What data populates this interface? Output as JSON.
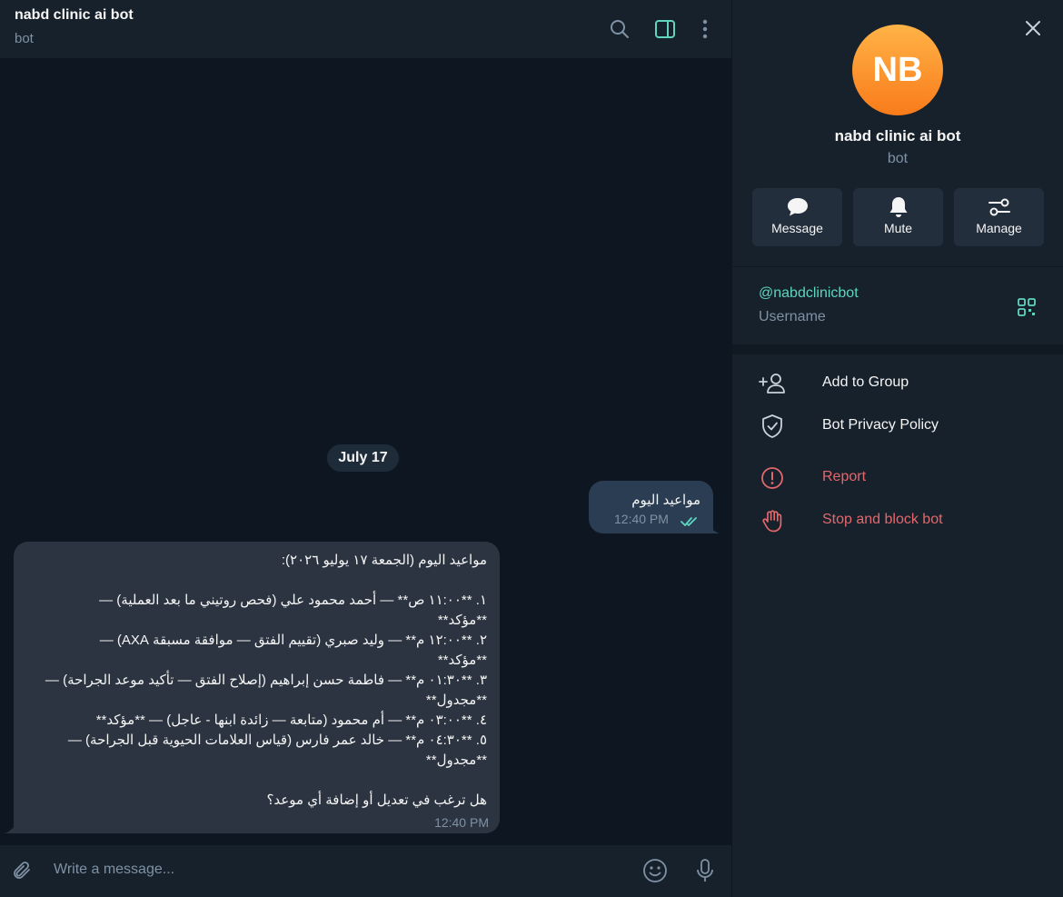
{
  "chat": {
    "title": "nabd clinic ai bot",
    "subtitle": "bot",
    "date_pill": "July 17",
    "outgoing": {
      "text": "مواعيد اليوم",
      "time": "12:40 PM"
    },
    "incoming": {
      "lines": [
        "مواعيد اليوم (الجمعة ١٧ يوليو ٢٠٢٦):",
        "",
        "١. **١١:٠٠ ص** — أحمد محمود علي (فحص روتيني ما بعد العملية) —",
        "**مؤكد**",
        "٢. **١٢:٠٠ م** — وليد صبري (تقييم الفتق — موافقة مسبقة AXA) —",
        "**مؤكد**",
        "٣. **٠١:٣٠ م** — فاطمة حسن إبراهيم (إصلاح الفتق — تأكيد موعد الجراحة) —",
        "**مجدول**",
        "٤. **٠٣:٠٠ م** — أم محمود (متابعة — زائدة ابنها - عاجل) — **مؤكد**",
        "٥. **٠٤:٣٠ م** — خالد عمر فارس (قياس العلامات الحيوية قبل الجراحة) —",
        "**مجدول**",
        "",
        "هل ترغب في تعديل أو إضافة أي موعد؟"
      ],
      "time": "12:40 PM"
    },
    "composer_placeholder": "Write a message..."
  },
  "panel": {
    "avatar_initials": "NB",
    "name": "nabd clinic ai bot",
    "subtitle": "bot",
    "actions": [
      {
        "label": "Message",
        "icon": "chat-bubble-icon"
      },
      {
        "label": "Mute",
        "icon": "bell-icon"
      },
      {
        "label": "Manage",
        "icon": "sliders-icon"
      }
    ],
    "username": "@nabdclinicbot",
    "username_label": "Username",
    "menu": [
      {
        "label": "Add to Group",
        "icon": "add-user-icon"
      },
      {
        "label": "Bot Privacy Policy",
        "icon": "shield-check-icon"
      },
      {
        "label": "Report",
        "icon": "alert-circle-icon"
      },
      {
        "label": "Stop and block bot",
        "icon": "hand-stop-icon"
      }
    ]
  },
  "colors": {
    "accent": "#5fd5c0",
    "danger": "#e4676b",
    "avatar_top": "#ffb347",
    "avatar_bottom": "#f97b1a",
    "panel_bg": "#17212b",
    "chat_bg": "#0e1621"
  }
}
